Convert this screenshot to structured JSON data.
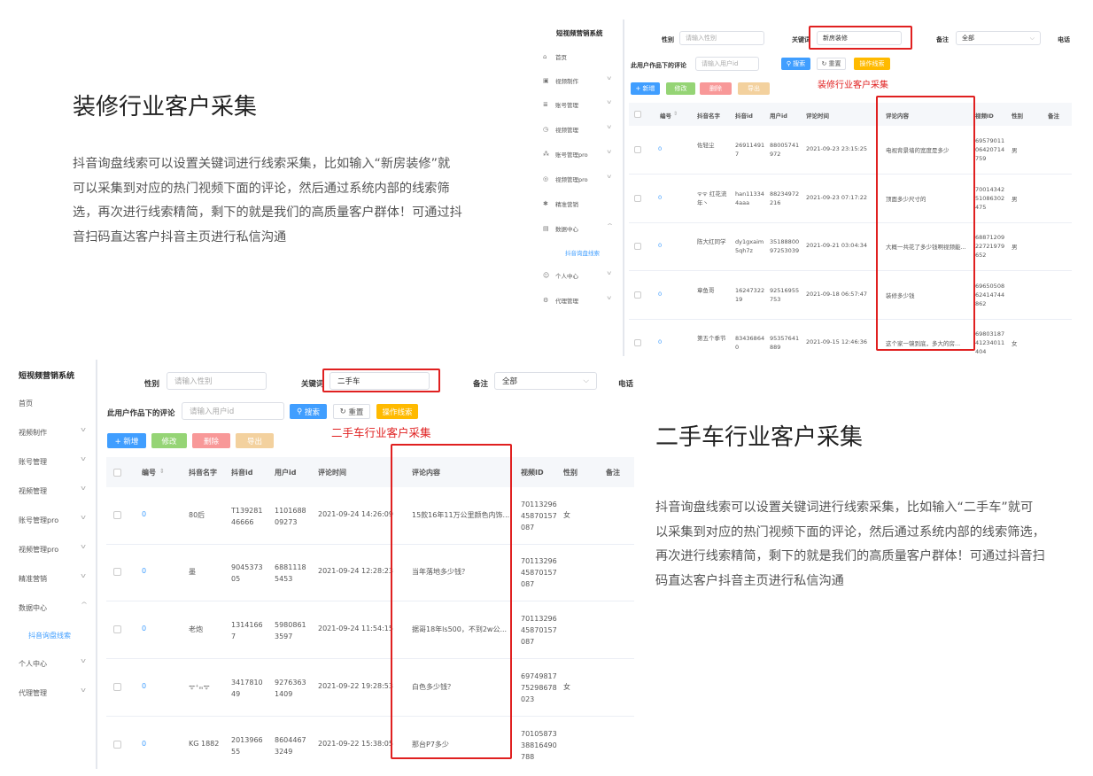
{
  "section1": {
    "title": "装修行业客户采集",
    "description": "抖音询盘线索可以设置关键词进行线索采集，比如输入“新房装修”就可以采集到对应的热门视频下面的评论，然后通过系统内部的线索筛选，再次进行线索精简，剩下的就是我们的高质量客户群体！可通过抖音扫码直达客户抖音主页进行私信沟通"
  },
  "section2": {
    "title": "二手车行业客户采集",
    "description": "抖音询盘线索可以设置关键词进行线索采集，比如输入“二手车”就可以采集到对应的热门视频下面的评论，然后通过系统内部的线索筛选，再次进行线索精简，剩下的就是我们的高质量客户群体！可通过抖音扫码直达客户抖音主页进行私信沟通"
  },
  "shot1": {
    "brand": "短视频营销系统",
    "nav": [
      {
        "label": "首页",
        "icon": "home-icon"
      },
      {
        "label": "视频制作",
        "icon": "video-icon"
      },
      {
        "label": "账号管理",
        "icon": "list-icon"
      },
      {
        "label": "视频管理",
        "icon": "clock-icon"
      },
      {
        "label": "账号管理pro",
        "icon": "sitemap-icon"
      },
      {
        "label": "视频管理pro",
        "icon": "target-icon"
      },
      {
        "label": "精准营销",
        "icon": "star-icon"
      },
      {
        "label": "数据中心",
        "icon": "data-icon"
      },
      {
        "label": "抖音询盘线索",
        "icon": ""
      },
      {
        "label": "个人中心",
        "icon": "user-icon"
      },
      {
        "label": "代理管理",
        "icon": "gear-icon"
      }
    ],
    "filters": {
      "gender_label": "性别",
      "gender_placeholder": "请输入性别",
      "keyword_label": "关键词",
      "keyword_value": "新房装修",
      "note_label": "备注",
      "note_value": "全部",
      "phone_label": "电话",
      "user_works_label": "此用户作品下的评论",
      "user_id_placeholder": "请输入用户id",
      "search": "搜索",
      "reset": "重置",
      "export": "操作线索"
    },
    "actions": {
      "add": "+ 新增",
      "edit": "修改",
      "delete": "删除",
      "export": "导出"
    },
    "annotation": "装修行业客户采集",
    "columns": [
      "编号",
      "抖音名字",
      "抖音id",
      "用户id",
      "评论时间",
      "评论内容",
      "视频ID",
      "性别",
      "备注"
    ],
    "rows": [
      {
        "num": "0",
        "name": "佐轻尘",
        "dyid": "269114917",
        "uid": "88005741972",
        "time": "2021-09-23 23:15:25",
        "comment": "电视背景墙的宽度是多少",
        "vid": "6957901106420714759",
        "gender": "男"
      },
      {
        "num": "0",
        "name": "ᯤᯤ 红花流年丶",
        "dyid": "han113344aaa",
        "uid": "88234972216",
        "time": "2021-09-23 07:17:22",
        "comment": "顶面多少尺寸的",
        "vid": "7001434251086302475",
        "gender": "男"
      },
      {
        "num": "0",
        "name": "陈大红同学",
        "dyid": "dy1gxaim5qh7z",
        "uid": "3518880097253039",
        "time": "2021-09-21 03:04:34",
        "comment": "大概一共花了多少钱啊视频能...",
        "vid": "6887120922721979652",
        "gender": "男"
      },
      {
        "num": "0",
        "name": "章鱼哥",
        "dyid": "1624732219",
        "uid": "92516955753",
        "time": "2021-09-18 06:57:47",
        "comment": "装修多少钱",
        "vid": "6965050862414744862",
        "gender": ""
      },
      {
        "num": "0",
        "name": "第五个季节",
        "dyid": "834368640",
        "uid": "95357641889",
        "time": "2021-09-15 12:46:36",
        "comment": "这个家一镜到底，多大的房...",
        "vid": "6980318741234011404",
        "gender": "女"
      }
    ]
  },
  "shot2": {
    "brand": "短视频营销系统",
    "nav": [
      {
        "label": "首页"
      },
      {
        "label": "视频制作"
      },
      {
        "label": "账号管理"
      },
      {
        "label": "视频管理"
      },
      {
        "label": "账号管理pro"
      },
      {
        "label": "视频管理pro"
      },
      {
        "label": "精准营销"
      },
      {
        "label": "数据中心"
      },
      {
        "label": "抖音询盘线索"
      },
      {
        "label": "个人中心"
      },
      {
        "label": "代理管理"
      }
    ],
    "filters": {
      "gender_label": "性别",
      "gender_placeholder": "请输入性别",
      "keyword_label": "关键词",
      "keyword_value": "二手车",
      "note_label": "备注",
      "note_value": "全部",
      "phone_label": "电话",
      "user_works_label": "此用户作品下的评论",
      "user_id_placeholder": "请输入用户id",
      "search": "搜索",
      "reset": "重置",
      "export": "操作线索"
    },
    "actions": {
      "add": "+ 新增",
      "edit": "修改",
      "delete": "删除",
      "export": "导出"
    },
    "annotation": "二手车行业客户采集",
    "columns": [
      "编号",
      "抖音名字",
      "抖音id",
      "用户id",
      "评论时间",
      "评论内容",
      "视频ID",
      "性别",
      "备注"
    ],
    "rows": [
      {
        "num": "0",
        "name": "80后",
        "dyid": "T13928146666",
        "uid": "110168809273",
        "time": "2021-09-24 14:26:09",
        "comment": "15款16年11万公里颜色内饰...",
        "vid": "7011329645870157087",
        "gender": "女"
      },
      {
        "num": "0",
        "name": "墨",
        "dyid": "904537305",
        "uid": "68811185453",
        "time": "2021-09-24 12:28:23",
        "comment": "当年落地多少钱？",
        "vid": "7011329645870157087",
        "gender": ""
      },
      {
        "num": "0",
        "name": "老炮",
        "dyid": "13141667",
        "uid": "59808613597",
        "time": "2021-09-24 11:54:15",
        "comment": "据哥18年ls500，不到2w公...",
        "vid": "7011329645870157087",
        "gender": ""
      },
      {
        "num": "0",
        "name": "ᯤ⁺ₘᯤ",
        "dyid": "341781049",
        "uid": "92763631409",
        "time": "2021-09-22 19:28:53",
        "comment": "白色多少钱？",
        "vid": "6974981775298678023",
        "gender": "女"
      },
      {
        "num": "0",
        "name": "KG 1882",
        "dyid": "201396655",
        "uid": "86044673249",
        "time": "2021-09-22 15:38:05",
        "comment": "那台P7多少",
        "vid": "7010587338816490788",
        "gender": ""
      }
    ]
  }
}
